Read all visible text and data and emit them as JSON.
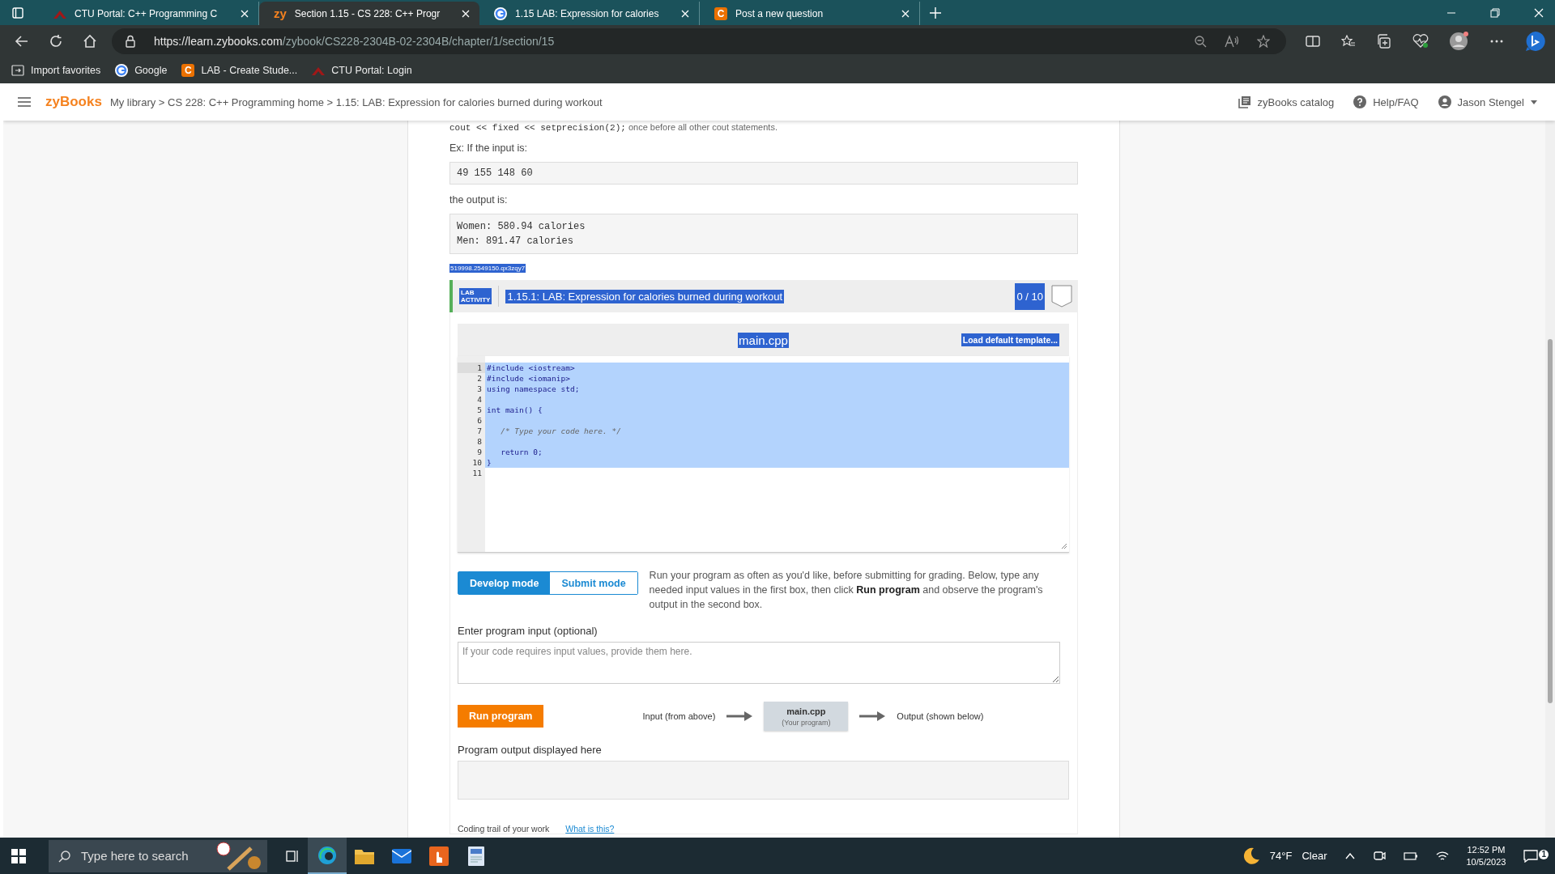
{
  "browser": {
    "tabs": [
      {
        "kind": "ctu",
        "title": "CTU Portal: C++ Programming C",
        "selected": false
      },
      {
        "kind": "zy",
        "logo": "zy",
        "title": "Section 1.15 - CS 228: C++ Progr",
        "selected": true
      },
      {
        "kind": "google",
        "title": "1.15 LAB: Expression for calories",
        "selected": false
      },
      {
        "kind": "chegg",
        "logo": "C",
        "title": "Post a new question",
        "selected": false
      }
    ],
    "url_host": "https://learn.zybooks.com",
    "url_path": "/zybook/CS228-2304B-02-2304B/chapter/1/section/15",
    "bookmarks": [
      {
        "kind": "import",
        "label": "Import favorites"
      },
      {
        "kind": "google",
        "label": "Google"
      },
      {
        "kind": "chegg",
        "logo": "C",
        "label": "LAB - Create Stude..."
      },
      {
        "kind": "ctu",
        "label": "CTU Portal: Login"
      }
    ]
  },
  "header": {
    "logo": "zyBooks",
    "breadcrumb": "My library > CS 228: C++ Programming home > 1.15: LAB: Expression for calories burned during workout",
    "links": [
      {
        "kind": "catalog",
        "label": "zyBooks catalog"
      },
      {
        "kind": "help",
        "label": "Help/FAQ"
      },
      {
        "kind": "user",
        "label": "Jason Stengel"
      }
    ]
  },
  "content": {
    "cut_code": "cout << fixed << setprecision(2);",
    "cut_text": "once before all other cout statements.",
    "example_label": "Ex: If the input is:",
    "input_example": "49 155 148 60",
    "output_label": "the output is:",
    "output_example": [
      "Women: 580.94 calories",
      "Men: 891.47 calories"
    ],
    "id_tag": "519998.2549150.qx3zqy7"
  },
  "lab": {
    "badge": [
      "LAB",
      "ACTIVITY"
    ],
    "title": "1.15.1: LAB: Expression for calories burned during workout",
    "score": "0 / 10",
    "file_name": "main.cpp",
    "load_button": "Load default template...",
    "code_lines": [
      {
        "number": "1",
        "kind": "code",
        "text": "#include <iostream>",
        "selected": true
      },
      {
        "number": "2",
        "kind": "code",
        "text": "#include <iomanip>",
        "selected": true
      },
      {
        "number": "3",
        "kind": "code",
        "text": "using namespace std;",
        "selected": true
      },
      {
        "number": "4",
        "kind": "code",
        "selected": true
      },
      {
        "number": "5",
        "kind": "code",
        "text": "int main() {",
        "selected": true
      },
      {
        "number": "6",
        "kind": "code",
        "selected": true
      },
      {
        "number": "7",
        "kind": "comment",
        "text": "   /* Type your code here. */",
        "selected": true
      },
      {
        "number": "8",
        "kind": "code",
        "selected": true
      },
      {
        "number": "9",
        "kind": "code",
        "text": "   return 0;",
        "selected": true
      },
      {
        "number": "10",
        "kind": "code",
        "text": "}",
        "selected": true
      },
      {
        "number": "11",
        "kind": "code",
        "selected": false
      }
    ],
    "modes": [
      {
        "label": "Develop mode",
        "selected": true
      },
      {
        "label": "Submit mode",
        "selected": false
      }
    ],
    "instructions": "Run your program as often as you'd like, before submitting for grading. Below, type any needed input values in the first box, then click **Run program** and observe the program's output in the second box.",
    "input_label": "Enter program input (optional)",
    "input_placeholder": "If your code requires input values, provide them here.",
    "run_button": "Run program",
    "flow": {
      "input": "Input (from above)",
      "program": "main.cpp",
      "program_note": "(Your program)",
      "output": "Output (shown below)"
    },
    "output_label": "Program output displayed here",
    "trail_label": "Coding trail of your work",
    "trail_link": "What is this?"
  },
  "taskbar": {
    "search_placeholder": "Type here to search",
    "temperature": "74°F",
    "weather": "Clear",
    "time": "12:52 PM",
    "date": "10/5/2023",
    "notifications": "1"
  }
}
